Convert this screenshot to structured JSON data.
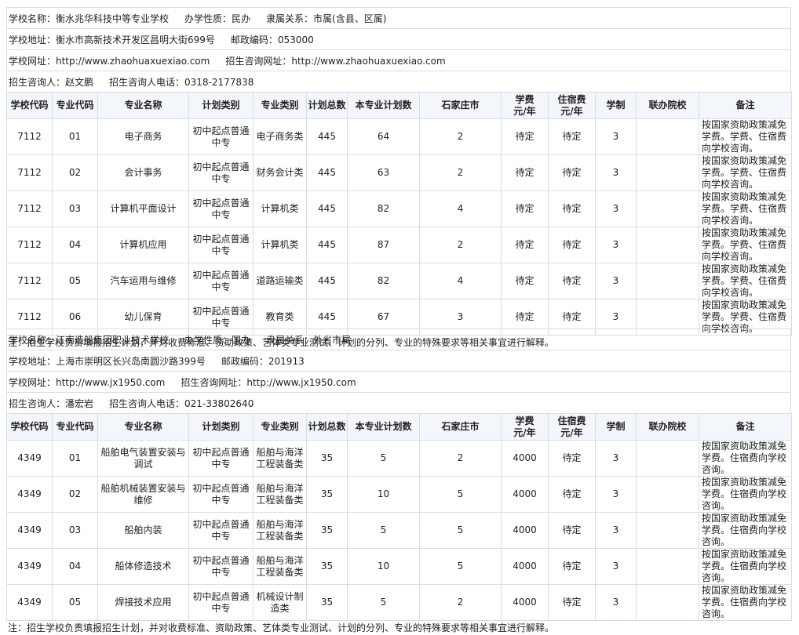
{
  "columns": [
    "学校代码",
    "专业代码",
    "专业名称",
    "计划类别",
    "专业类别",
    "计划总数",
    "本专业计划数",
    "石家庄市",
    "学费\n元/年",
    "住宿费\n元/年",
    "学制",
    "联办院校",
    "备注"
  ],
  "footnote": "注：招生学校负责填报招生计划，并对收费标准、资助政策、艺体类专业测试、计划的分列、专业的特殊要求等相关事宜进行解释。",
  "schools": [
    {
      "info": [
        [
          "学校名称：衡水兆华科技中等专业学校",
          "办学性质：民办",
          "隶属关系：市属(含县、区属)"
        ],
        [
          "学校地址：衡水市高新技术开发区昌明大街699号",
          "邮政编码：053000"
        ],
        [
          "学校网址：http://www.zhaohuaxuexiao.com",
          "招生咨询网址：http://www.zhaohuaxuexiao.com"
        ],
        [
          "招生咨询人：赵文鹏",
          "招生咨询人电话：0318-2177838"
        ]
      ],
      "rows": [
        [
          "7112",
          "01",
          "电子商务",
          "初中起点普通中专",
          "电子商务类",
          "445",
          "64",
          "2",
          "待定",
          "待定",
          "3",
          "",
          "按国家资助政策减免学费。学费、住宿费向学校咨询。"
        ],
        [
          "7112",
          "02",
          "会计事务",
          "初中起点普通中专",
          "财务会计类",
          "445",
          "63",
          "2",
          "待定",
          "待定",
          "3",
          "",
          "按国家资助政策减免学费。学费、住宿费向学校咨询。"
        ],
        [
          "7112",
          "03",
          "计算机平面设计",
          "初中起点普通中专",
          "计算机类",
          "445",
          "82",
          "4",
          "待定",
          "待定",
          "3",
          "",
          "按国家资助政策减免学费。学费、住宿费向学校咨询。"
        ],
        [
          "7112",
          "04",
          "计算机应用",
          "初中起点普通中专",
          "计算机类",
          "445",
          "87",
          "2",
          "待定",
          "待定",
          "3",
          "",
          "按国家资助政策减免学费。学费、住宿费向学校咨询。"
        ],
        [
          "7112",
          "05",
          "汽车运用与维修",
          "初中起点普通中专",
          "道路运输类",
          "445",
          "82",
          "4",
          "待定",
          "待定",
          "3",
          "",
          "按国家资助政策减免学费。学费、住宿费向学校咨询。"
        ],
        [
          "7112",
          "06",
          "幼儿保育",
          "初中起点普通中专",
          "教育类",
          "445",
          "67",
          "3",
          "待定",
          "待定",
          "3",
          "",
          "按国家资助政策减免学费。学费、住宿费向学校咨询。"
        ]
      ]
    },
    {
      "info": [
        [
          "学校名称：江南造船集团职业技术学校",
          "办学性质：国办",
          "隶属关系：外省市属"
        ],
        [
          "学校地址：上海市崇明区长兴岛南圆沙路399号",
          "邮政编码：201913"
        ],
        [
          "学校网址：http://www.jx1950.com",
          "招生咨询网址：http://www.jx1950.com"
        ],
        [
          "招生咨询人：潘宏岩",
          "招生咨询人电话：021-33802640"
        ]
      ],
      "rows": [
        [
          "4349",
          "01",
          "船舶电气装置安装与调试",
          "初中起点普通中专",
          "船舶与海洋工程装备类",
          "35",
          "5",
          "2",
          "4000",
          "待定",
          "3",
          "",
          "按国家资助政策减免学费。住宿费向学校咨询。"
        ],
        [
          "4349",
          "02",
          "船舶机械装置安装与维修",
          "初中起点普通中专",
          "船舶与海洋工程装备类",
          "35",
          "10",
          "5",
          "4000",
          "待定",
          "3",
          "",
          "按国家资助政策减免学费。住宿费向学校咨询。"
        ],
        [
          "4349",
          "03",
          "船舶内装",
          "初中起点普通中专",
          "船舶与海洋工程装备类",
          "35",
          "5",
          "5",
          "4000",
          "待定",
          "3",
          "",
          "按国家资助政策减免学费。住宿费向学校咨询。"
        ],
        [
          "4349",
          "04",
          "船体修造技术",
          "初中起点普通中专",
          "船舶与海洋工程装备类",
          "35",
          "10",
          "5",
          "4000",
          "待定",
          "3",
          "",
          "按国家资助政策减免学费。住宿费向学校咨询。"
        ],
        [
          "4349",
          "05",
          "焊接技术应用",
          "初中起点普通中专",
          "机械设计制造类",
          "35",
          "5",
          "2",
          "4000",
          "待定",
          "3",
          "",
          "按国家资助政策减免学费。住宿费向学校咨询。"
        ]
      ]
    }
  ]
}
